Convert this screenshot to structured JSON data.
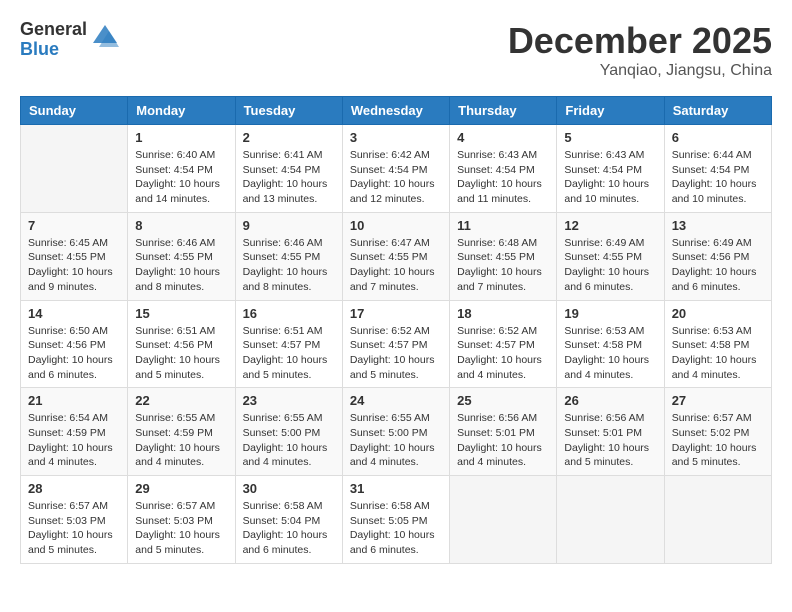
{
  "logo": {
    "general": "General",
    "blue": "Blue"
  },
  "header": {
    "month": "December 2025",
    "location": "Yanqiao, Jiangsu, China"
  },
  "days_of_week": [
    "Sunday",
    "Monday",
    "Tuesday",
    "Wednesday",
    "Thursday",
    "Friday",
    "Saturday"
  ],
  "weeks": [
    [
      {
        "day": "",
        "info": ""
      },
      {
        "day": "1",
        "info": "Sunrise: 6:40 AM\nSunset: 4:54 PM\nDaylight: 10 hours\nand 14 minutes."
      },
      {
        "day": "2",
        "info": "Sunrise: 6:41 AM\nSunset: 4:54 PM\nDaylight: 10 hours\nand 13 minutes."
      },
      {
        "day": "3",
        "info": "Sunrise: 6:42 AM\nSunset: 4:54 PM\nDaylight: 10 hours\nand 12 minutes."
      },
      {
        "day": "4",
        "info": "Sunrise: 6:43 AM\nSunset: 4:54 PM\nDaylight: 10 hours\nand 11 minutes."
      },
      {
        "day": "5",
        "info": "Sunrise: 6:43 AM\nSunset: 4:54 PM\nDaylight: 10 hours\nand 10 minutes."
      },
      {
        "day": "6",
        "info": "Sunrise: 6:44 AM\nSunset: 4:54 PM\nDaylight: 10 hours\nand 10 minutes."
      }
    ],
    [
      {
        "day": "7",
        "info": "Sunrise: 6:45 AM\nSunset: 4:55 PM\nDaylight: 10 hours\nand 9 minutes."
      },
      {
        "day": "8",
        "info": "Sunrise: 6:46 AM\nSunset: 4:55 PM\nDaylight: 10 hours\nand 8 minutes."
      },
      {
        "day": "9",
        "info": "Sunrise: 6:46 AM\nSunset: 4:55 PM\nDaylight: 10 hours\nand 8 minutes."
      },
      {
        "day": "10",
        "info": "Sunrise: 6:47 AM\nSunset: 4:55 PM\nDaylight: 10 hours\nand 7 minutes."
      },
      {
        "day": "11",
        "info": "Sunrise: 6:48 AM\nSunset: 4:55 PM\nDaylight: 10 hours\nand 7 minutes."
      },
      {
        "day": "12",
        "info": "Sunrise: 6:49 AM\nSunset: 4:55 PM\nDaylight: 10 hours\nand 6 minutes."
      },
      {
        "day": "13",
        "info": "Sunrise: 6:49 AM\nSunset: 4:56 PM\nDaylight: 10 hours\nand 6 minutes."
      }
    ],
    [
      {
        "day": "14",
        "info": "Sunrise: 6:50 AM\nSunset: 4:56 PM\nDaylight: 10 hours\nand 6 minutes."
      },
      {
        "day": "15",
        "info": "Sunrise: 6:51 AM\nSunset: 4:56 PM\nDaylight: 10 hours\nand 5 minutes."
      },
      {
        "day": "16",
        "info": "Sunrise: 6:51 AM\nSunset: 4:57 PM\nDaylight: 10 hours\nand 5 minutes."
      },
      {
        "day": "17",
        "info": "Sunrise: 6:52 AM\nSunset: 4:57 PM\nDaylight: 10 hours\nand 5 minutes."
      },
      {
        "day": "18",
        "info": "Sunrise: 6:52 AM\nSunset: 4:57 PM\nDaylight: 10 hours\nand 4 minutes."
      },
      {
        "day": "19",
        "info": "Sunrise: 6:53 AM\nSunset: 4:58 PM\nDaylight: 10 hours\nand 4 minutes."
      },
      {
        "day": "20",
        "info": "Sunrise: 6:53 AM\nSunset: 4:58 PM\nDaylight: 10 hours\nand 4 minutes."
      }
    ],
    [
      {
        "day": "21",
        "info": "Sunrise: 6:54 AM\nSunset: 4:59 PM\nDaylight: 10 hours\nand 4 minutes."
      },
      {
        "day": "22",
        "info": "Sunrise: 6:55 AM\nSunset: 4:59 PM\nDaylight: 10 hours\nand 4 minutes."
      },
      {
        "day": "23",
        "info": "Sunrise: 6:55 AM\nSunset: 5:00 PM\nDaylight: 10 hours\nand 4 minutes."
      },
      {
        "day": "24",
        "info": "Sunrise: 6:55 AM\nSunset: 5:00 PM\nDaylight: 10 hours\nand 4 minutes."
      },
      {
        "day": "25",
        "info": "Sunrise: 6:56 AM\nSunset: 5:01 PM\nDaylight: 10 hours\nand 4 minutes."
      },
      {
        "day": "26",
        "info": "Sunrise: 6:56 AM\nSunset: 5:01 PM\nDaylight: 10 hours\nand 5 minutes."
      },
      {
        "day": "27",
        "info": "Sunrise: 6:57 AM\nSunset: 5:02 PM\nDaylight: 10 hours\nand 5 minutes."
      }
    ],
    [
      {
        "day": "28",
        "info": "Sunrise: 6:57 AM\nSunset: 5:03 PM\nDaylight: 10 hours\nand 5 minutes."
      },
      {
        "day": "29",
        "info": "Sunrise: 6:57 AM\nSunset: 5:03 PM\nDaylight: 10 hours\nand 5 minutes."
      },
      {
        "day": "30",
        "info": "Sunrise: 6:58 AM\nSunset: 5:04 PM\nDaylight: 10 hours\nand 6 minutes."
      },
      {
        "day": "31",
        "info": "Sunrise: 6:58 AM\nSunset: 5:05 PM\nDaylight: 10 hours\nand 6 minutes."
      },
      {
        "day": "",
        "info": ""
      },
      {
        "day": "",
        "info": ""
      },
      {
        "day": "",
        "info": ""
      }
    ]
  ]
}
